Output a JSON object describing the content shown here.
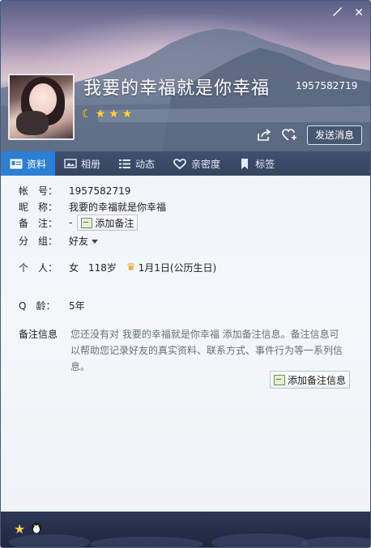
{
  "window": {
    "controls": {
      "skin_icon": "paintbrush-icon",
      "close_icon": "close-icon",
      "close_glyph": "✕"
    }
  },
  "profile": {
    "nickname": "我要的幸福就是你幸福",
    "qq_number": "1957582719",
    "level_icons": [
      "moon-icon",
      "star-icon",
      "star-icon",
      "star-icon"
    ],
    "send_message_label": "发送消息"
  },
  "tabs": [
    {
      "label": "资料",
      "icon": "profile-card-icon",
      "active": true
    },
    {
      "label": "相册",
      "icon": "album-icon",
      "active": false
    },
    {
      "label": "动态",
      "icon": "feed-list-icon",
      "active": false
    },
    {
      "label": "亲密度",
      "icon": "heart-icon",
      "active": false
    },
    {
      "label": "标签",
      "icon": "bookmark-icon",
      "active": false
    }
  ],
  "details": {
    "account": {
      "label": "帐　号：",
      "value": "1957582719"
    },
    "nickname": {
      "label": "昵　称：",
      "value": "我要的幸福就是你幸福"
    },
    "remark": {
      "label": "备　注：",
      "value": "-",
      "button": "添加备注"
    },
    "group": {
      "label": "分　组：",
      "value": "好友"
    },
    "personal": {
      "label": "个　人：",
      "gender": "女",
      "age": "118岁",
      "birthday": "1月1日(公历生日)"
    },
    "q_age": {
      "label": "Q　龄：",
      "value": "5年"
    },
    "remark_info": {
      "label": "备注信息",
      "text": "您还没有对 我要的幸福就是你幸福 添加备注信息。备注信息可以帮助您记录好友的真实资料、联系方式、事件行为等一系列信息。",
      "button": "添加备注信息"
    }
  },
  "footer": {
    "icons": [
      "star-icon",
      "qq-penguin-icon"
    ]
  },
  "colors": {
    "tab_active": "#2c7fd4",
    "tab_bar": "#3b4a66",
    "level_star": "#ffd23e"
  }
}
